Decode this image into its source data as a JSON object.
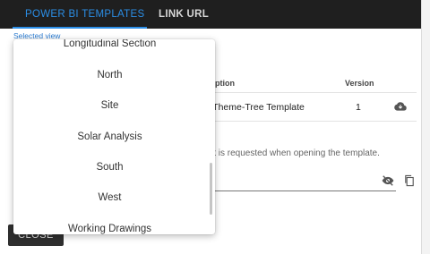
{
  "tabs": [
    {
      "label": "POWER BI TEMPLATES"
    },
    {
      "label": "LINK URL"
    }
  ],
  "selected_view_label": "Selected view",
  "table": {
    "columns": [
      "cription",
      "Version"
    ],
    "rows": [
      {
        "description": "il-Theme-Tree Template",
        "version": "1"
      }
    ]
  },
  "hint_text": "it is requested when opening the template.",
  "close_label": "CLOSE",
  "dropdown": {
    "options": [
      "Longitudinal Section",
      "North",
      "Site",
      "Solar Analysis",
      "South",
      "West",
      "Working Drawings"
    ]
  },
  "colors": {
    "accent": "#2b8ee6",
    "topbar": "#1f1f1f",
    "button": "#2f2f2f"
  }
}
